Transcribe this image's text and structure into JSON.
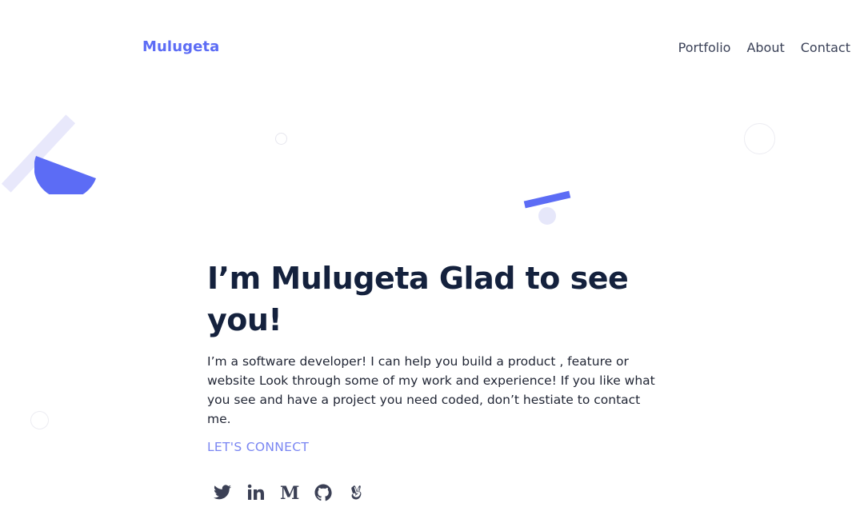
{
  "header": {
    "logo": "Mulugeta",
    "nav": [
      "Portfolio",
      "About",
      "Contact"
    ]
  },
  "hero": {
    "heading": "I’m Mulugeta Glad to see you!",
    "description": "I’m a software developer! I can help you build a product , feature or website Look through some of my work and experience! If you like what you see and have a project you need coded, don’t hestiate to contact me.",
    "cta": "LET'S CONNECT"
  },
  "socials": [
    {
      "name": "twitter",
      "icon": "twitter-icon"
    },
    {
      "name": "linkedin",
      "icon": "linkedin-icon"
    },
    {
      "name": "medium",
      "icon": "medium-icon"
    },
    {
      "name": "github",
      "icon": "github-icon"
    },
    {
      "name": "angellist",
      "icon": "angellist-icon"
    }
  ],
  "colors": {
    "accent": "#5c6cf5",
    "heading": "#14213d",
    "cta": "#7a86f2",
    "decor_light": "#e8e8fb"
  }
}
